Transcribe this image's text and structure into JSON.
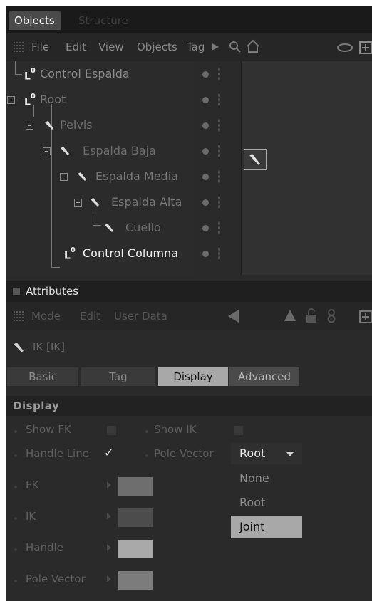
{
  "window": {
    "tabs": [
      {
        "label": "Objects",
        "active": true
      },
      {
        "label": "Structure",
        "active": false
      }
    ]
  },
  "object_manager": {
    "menu": [
      "File",
      "Edit",
      "View",
      "Objects",
      "Tag"
    ],
    "tree": [
      {
        "label": "Control Espalda",
        "icon": "null-object-icon",
        "level": 0
      },
      {
        "label": "Root",
        "icon": "null-object-icon",
        "level": 0
      },
      {
        "label": "Pelvis",
        "icon": "bone-icon",
        "level": 1
      },
      {
        "label": "Espalda Baja",
        "icon": "bone-icon",
        "level": 2
      },
      {
        "label": "Espalda Media",
        "icon": "bone-icon",
        "level": 3
      },
      {
        "label": "Espalda Alta",
        "icon": "bone-icon",
        "level": 4
      },
      {
        "label": "Cuello",
        "icon": "bone-icon",
        "level": 5
      },
      {
        "label": "Control Columna",
        "icon": "null-object-icon",
        "level": 1
      }
    ],
    "null_glyph": "L",
    "null_glyph_sup": "0"
  },
  "attributes": {
    "title": "Attributes",
    "menu": [
      "Mode",
      "Edit",
      "User Data"
    ],
    "object_label": "IK [IK]",
    "tabs": [
      {
        "label": "Basic",
        "active": false
      },
      {
        "label": "Tag",
        "active": false
      },
      {
        "label": "Display",
        "active": true
      },
      {
        "label": "Advanced",
        "active": false
      }
    ],
    "group": "Display",
    "show_fk_label": "Show FK",
    "show_fk_checked": false,
    "show_ik_label": "Show IK",
    "show_ik_checked": false,
    "handle_line_label": "Handle Line",
    "handle_line_checked": true,
    "handle_line_mark": "✓",
    "pole_vector_label": "Pole Vector",
    "pole_vector_value": "Root",
    "pole_vector_options": [
      {
        "label": "None",
        "selected": false
      },
      {
        "label": "Root",
        "selected": false
      },
      {
        "label": "Joint",
        "selected": true
      }
    ],
    "color_fields": [
      {
        "label": "FK",
        "color": "#6e6e6e"
      },
      {
        "label": "IK",
        "color": "#4c4c4c"
      },
      {
        "label": "Handle",
        "color": "#a9a9a9"
      },
      {
        "label": "Pole Vector",
        "color": "#7c7c7c"
      }
    ]
  }
}
